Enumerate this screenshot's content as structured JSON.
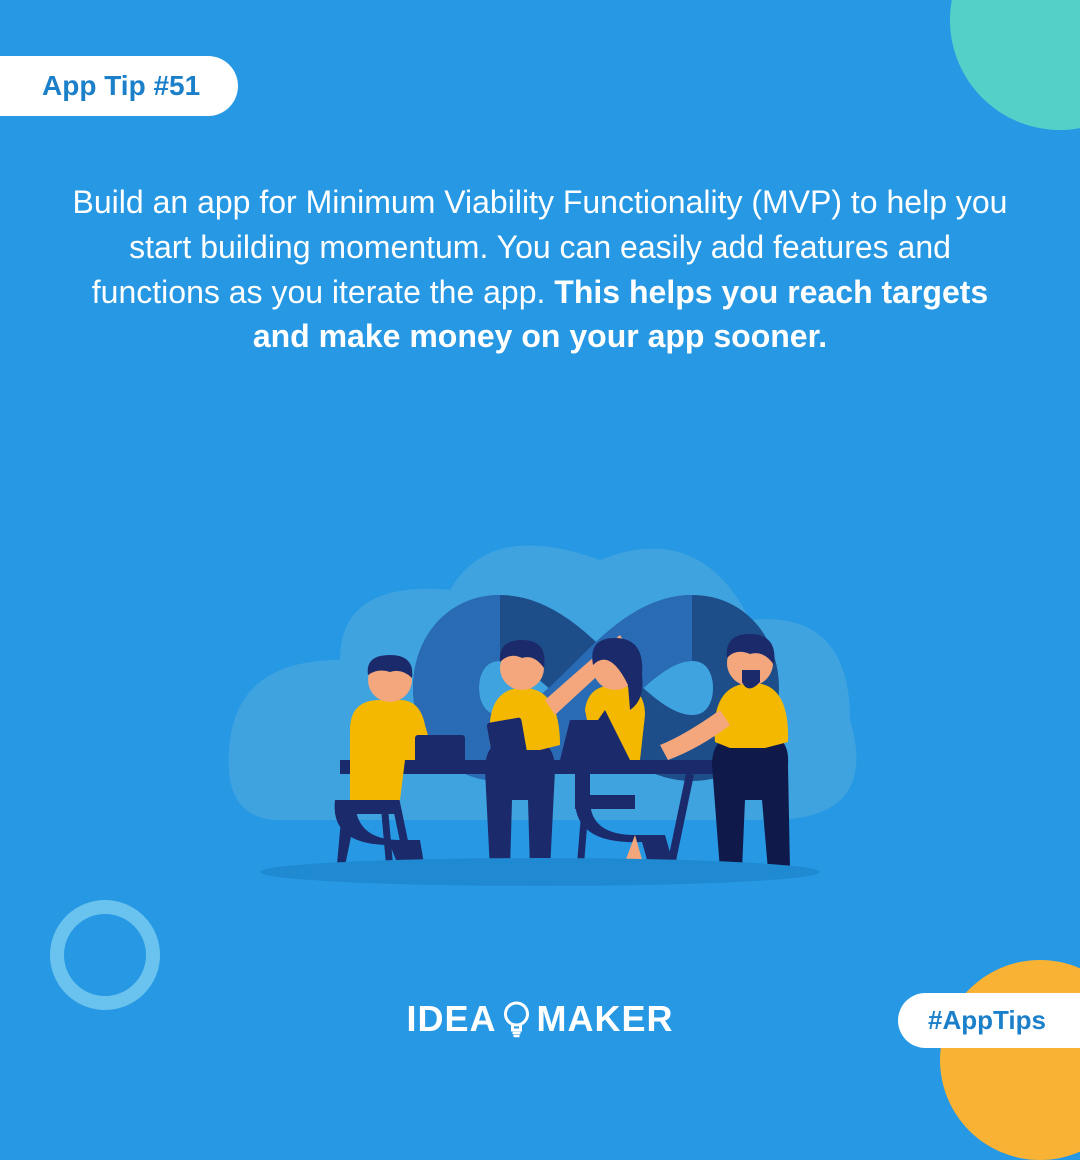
{
  "badge": "App Tip #51",
  "tip_regular": "Build an app for Minimum Viability Functionality (MVP) to help you start building momentum. You can easily add features and functions as you iterate the app. ",
  "tip_bold": "This helps you reach targets and make money on your app sooner.",
  "logo_left": "IDEA",
  "logo_right": "MAKER",
  "hashtag": "#AppTips",
  "colors": {
    "bg": "#2798e3",
    "accent_teal": "#55d0c9",
    "accent_orange": "#f9b233",
    "ring": "#6ac3ee",
    "white": "#ffffff",
    "brand_blue": "#1c7fc9"
  }
}
